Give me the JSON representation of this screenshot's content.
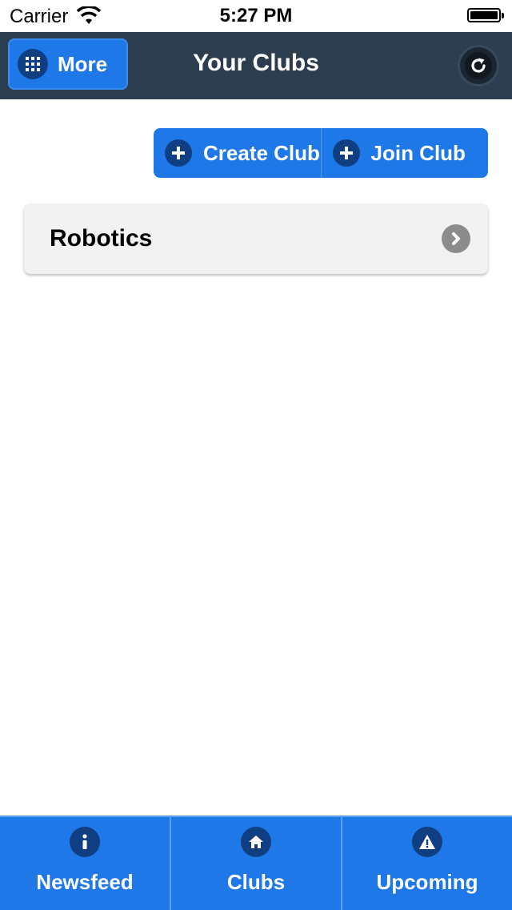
{
  "status_bar": {
    "carrier": "Carrier",
    "time": "5:27 PM"
  },
  "header": {
    "more_label": "More",
    "title": "Your Clubs"
  },
  "actions": {
    "create_label": "Create Club",
    "join_label": "Join Club"
  },
  "clubs": [
    {
      "name": "Robotics"
    }
  ],
  "tabs": [
    {
      "label": "Newsfeed",
      "icon": "info-icon"
    },
    {
      "label": "Clubs",
      "icon": "home-icon"
    },
    {
      "label": "Upcoming",
      "icon": "warning-icon"
    }
  ],
  "colors": {
    "accent": "#1e78e8",
    "header_bg": "#2d3d50",
    "icon_bg": "#0f3f82",
    "list_item_bg": "#f2f2f2"
  }
}
